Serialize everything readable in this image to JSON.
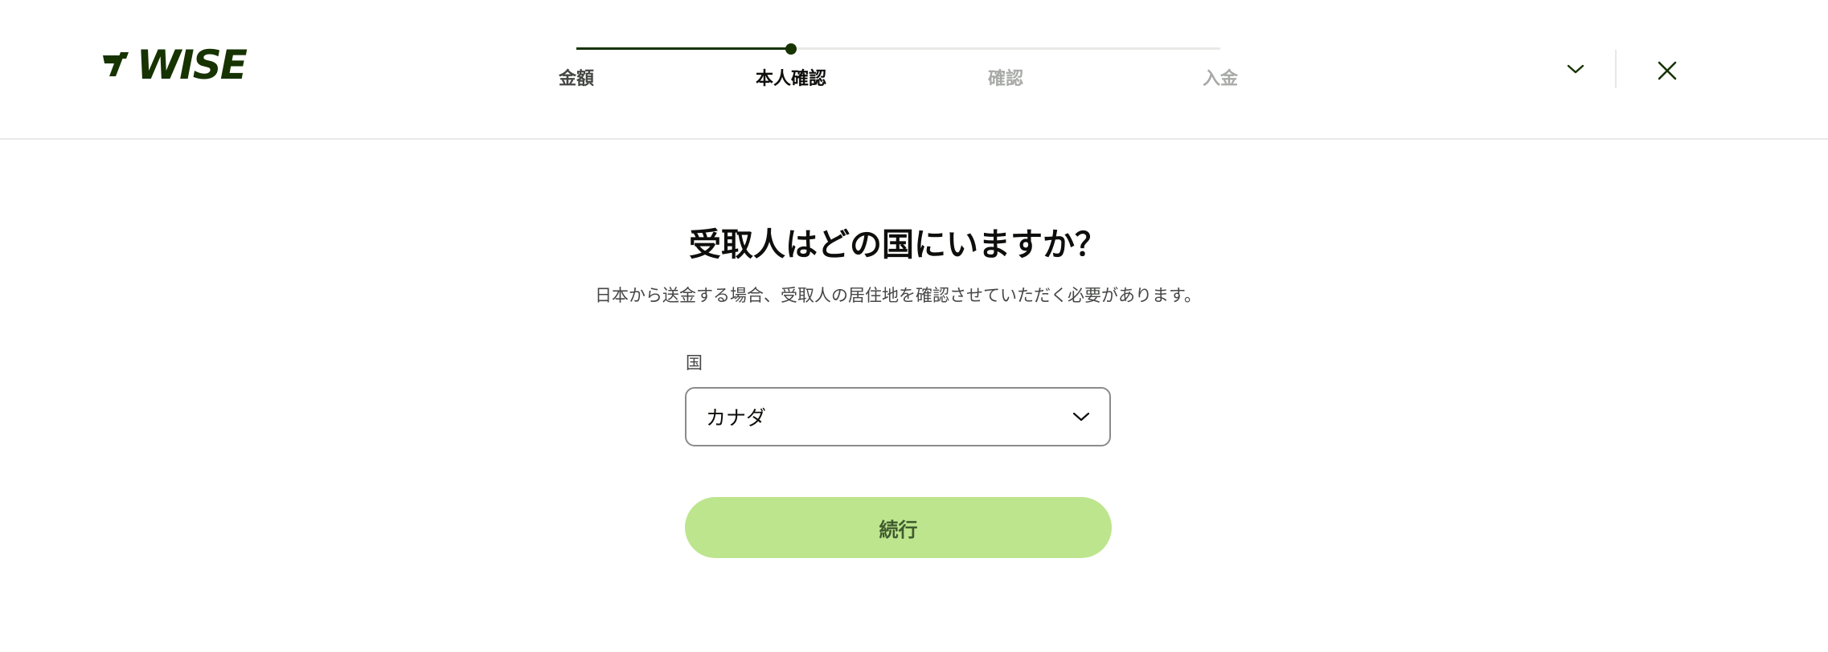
{
  "header": {
    "logo_text": "WISE",
    "brand_color": "#163300",
    "steps": [
      {
        "label": "金額",
        "state": "done"
      },
      {
        "label": "本人確認",
        "state": "active"
      },
      {
        "label": "確認",
        "state": "todo"
      },
      {
        "label": "入金",
        "state": "todo"
      }
    ],
    "progress_percent": 33,
    "menu_icon": "chevron-down-icon",
    "close_icon": "close-icon"
  },
  "main": {
    "title": "受取人はどの国にいますか？",
    "subtitle": "日本から送金する場合、受取人の居住地を確認させていただく必要があります。",
    "country_field": {
      "label": "国",
      "value": "カナダ"
    },
    "continue_label": "続行",
    "continue_color": "#bde58e"
  }
}
